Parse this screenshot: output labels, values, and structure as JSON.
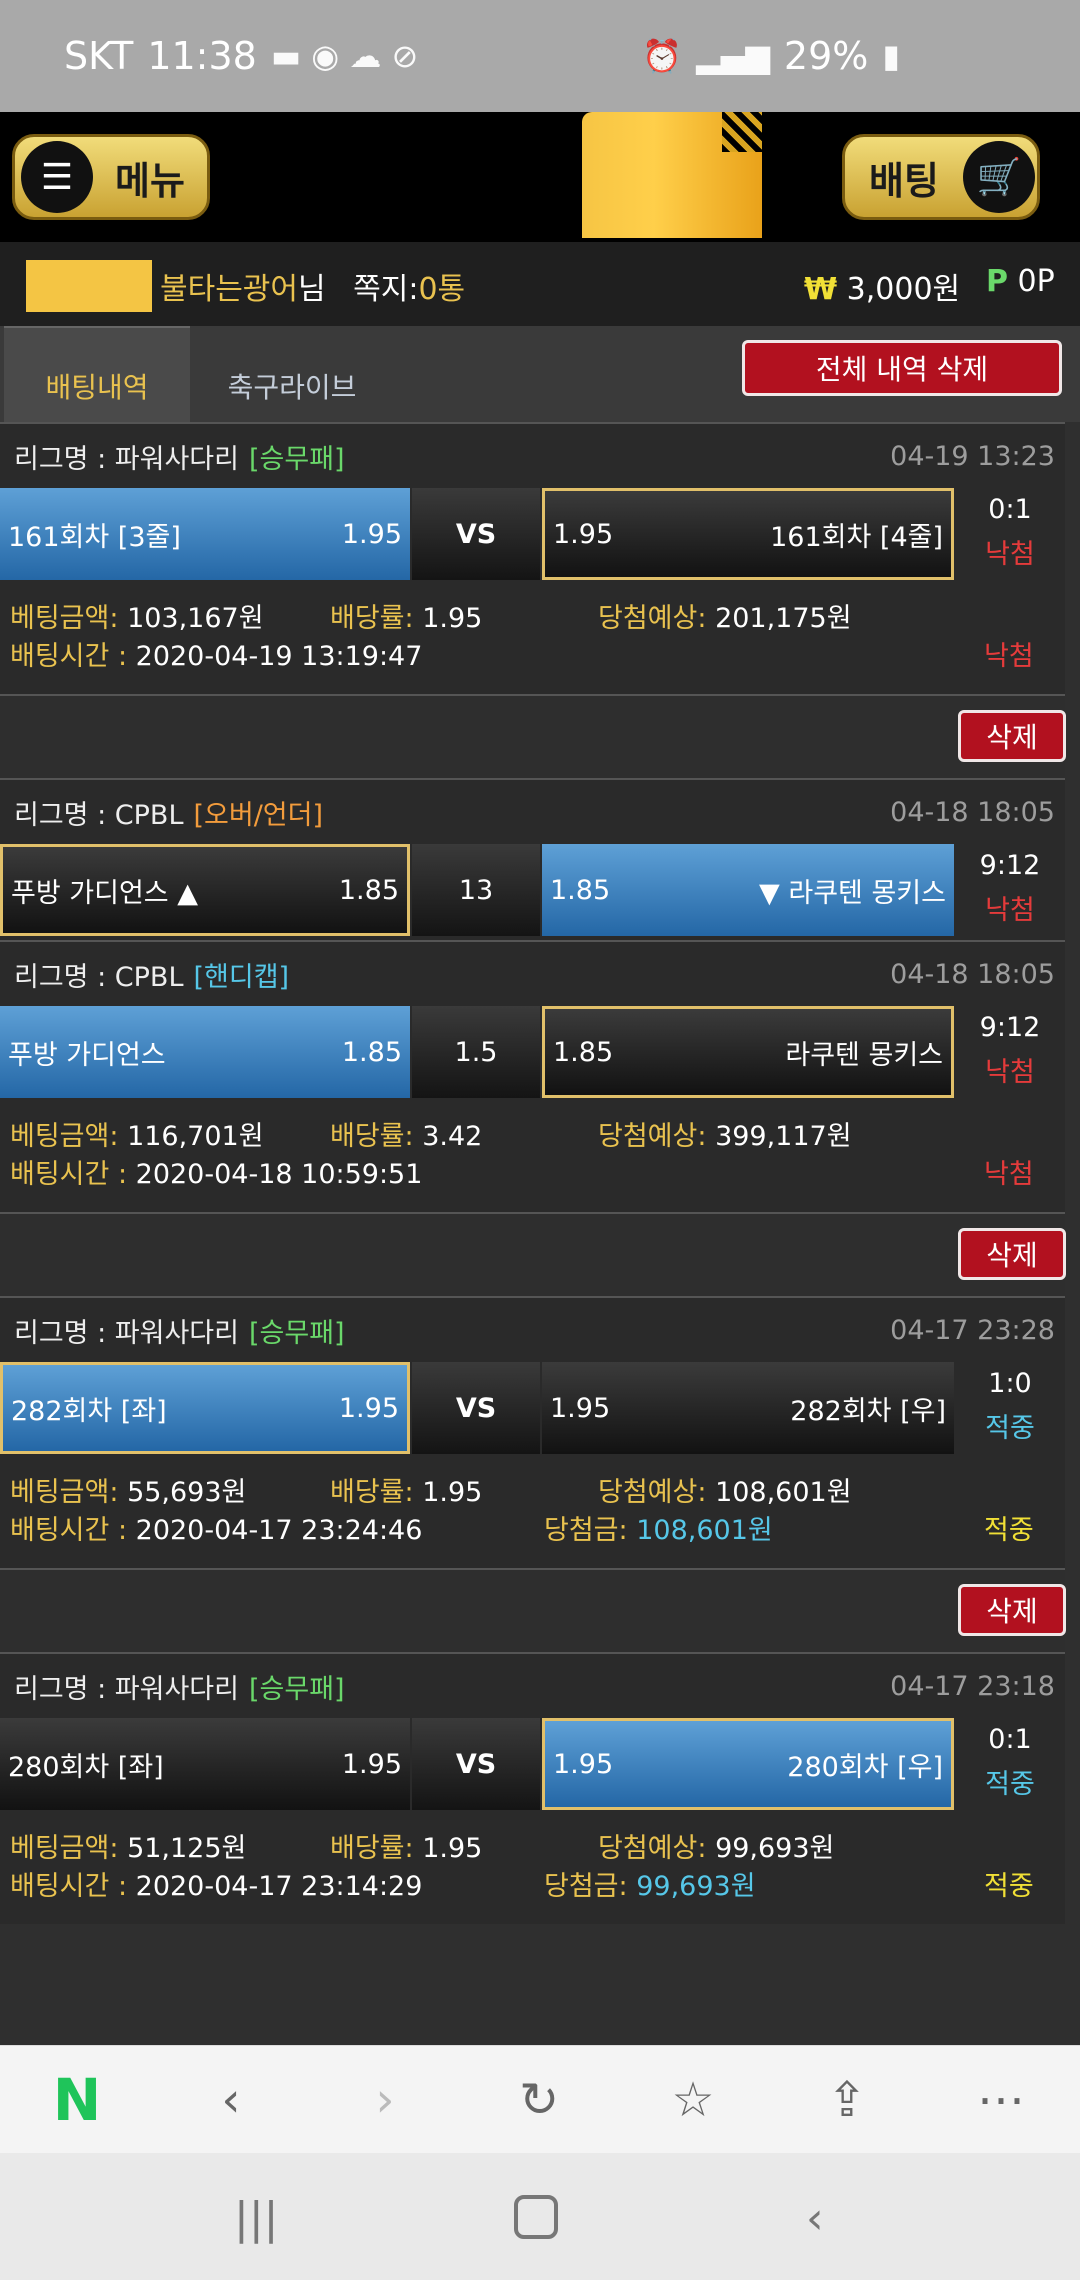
{
  "status": {
    "carrier": "SKT",
    "time": "11:38",
    "battery": "29%"
  },
  "topbar": {
    "menu_label": "메뉴",
    "bet_label": "배팅"
  },
  "user": {
    "name": "불타는광어",
    "suffix": "님",
    "message_label": "쪽지:",
    "message_count": "0통",
    "money": "3,000원",
    "points": "0P"
  },
  "tabs": {
    "history": "배팅내역",
    "soccer_live": "축구라이브",
    "delete_all": "전체 내역 삭제"
  },
  "bets": [
    {
      "leagues": [
        {
          "name": "리그명 : 파워사다리",
          "type": "[승무패]",
          "type_color": "green",
          "date": "04-19 13:23",
          "home": "161회차 [3줄]",
          "home_odds": "1.95",
          "mid": "VS",
          "away_odds": "1.95",
          "away": "161회차 [4줄]",
          "score": "0:1",
          "result": "낙첨"
        }
      ],
      "amount_label": "베팅금액:",
      "amount": "103,167원",
      "rate_label": "배당률:",
      "rate": "1.95",
      "expect_label": "당첨예상:",
      "expect": "201,175원",
      "time_label": "배팅시간 :",
      "time": "2020-04-19 13:19:47",
      "win_label": "",
      "win": "",
      "status": "낙첨",
      "delete": "삭제"
    },
    {
      "leagues": [
        {
          "name": "리그명 : CPBL",
          "type": "[오버/언더]",
          "type_color": "orange",
          "date": "04-18 18:05",
          "home": "푸방 가디언스 ▲",
          "home_odds": "1.85",
          "mid": "13",
          "away_odds": "1.85",
          "away": "▼ 라쿠텐 몽키스",
          "score": "9:12",
          "result": "낙첨"
        },
        {
          "name": "리그명 : CPBL",
          "type": "[핸디캡]",
          "type_color": "cyan",
          "date": "04-18 18:05",
          "home": "푸방 가디언스",
          "home_odds": "1.85",
          "mid": "1.5",
          "away_odds": "1.85",
          "away": "라쿠텐 몽키스",
          "score": "9:12",
          "result": "낙첨"
        }
      ],
      "amount_label": "베팅금액:",
      "amount": "116,701원",
      "rate_label": "배당률:",
      "rate": "3.42",
      "expect_label": "당첨예상:",
      "expect": "399,117원",
      "time_label": "배팅시간 :",
      "time": "2020-04-18 10:59:51",
      "win_label": "",
      "win": "",
      "status": "낙첨",
      "delete": "삭제"
    },
    {
      "leagues": [
        {
          "name": "리그명 : 파워사다리",
          "type": "[승무패]",
          "type_color": "green",
          "date": "04-17 23:28",
          "home": "282회차 [좌]",
          "home_odds": "1.95",
          "mid": "VS",
          "away_odds": "1.95",
          "away": "282회차 [우]",
          "score": "1:0",
          "result": "적중"
        }
      ],
      "amount_label": "베팅금액:",
      "amount": "55,693원",
      "rate_label": "배당률:",
      "rate": "1.95",
      "expect_label": "당첨예상:",
      "expect": "108,601원",
      "time_label": "배팅시간 :",
      "time": "2020-04-17 23:24:46",
      "win_label": "당첨금:",
      "win": "108,601원",
      "status": "적중",
      "delete": "삭제"
    },
    {
      "leagues": [
        {
          "name": "리그명 : 파워사다리",
          "type": "[승무패]",
          "type_color": "green",
          "date": "04-17 23:18",
          "home": "280회차 [좌]",
          "home_odds": "1.95",
          "mid": "VS",
          "away_odds": "1.95",
          "away": "280회차 [우]",
          "score": "0:1",
          "result": "적중"
        }
      ],
      "amount_label": "베팅금액:",
      "amount": "51,125원",
      "rate_label": "배당률:",
      "rate": "1.95",
      "expect_label": "당첨예상:",
      "expect": "99,693원",
      "time_label": "배팅시간 :",
      "time": "2020-04-17 23:14:29",
      "win_label": "당첨금:",
      "win": "99,693원",
      "status": "적중"
    }
  ]
}
